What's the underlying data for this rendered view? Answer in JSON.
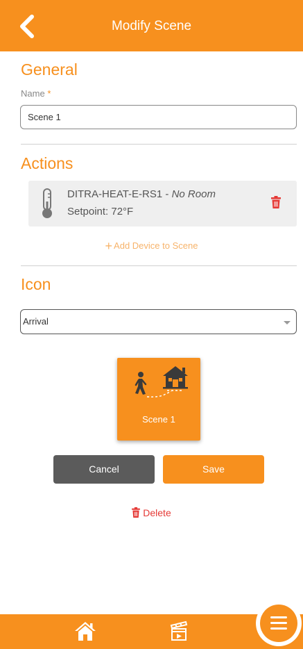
{
  "header": {
    "title": "Modify Scene",
    "back_icon": "chevron-left-icon"
  },
  "general": {
    "title": "General",
    "name_label": "Name",
    "required_mark": "*",
    "name_value": "Scene 1"
  },
  "actions": {
    "title": "Actions",
    "devices": [
      {
        "name": "DITRA-HEAT-E-RS1",
        "separator": " - ",
        "room": "No Room",
        "setpoint": "Setpoint: 72°F",
        "icon": "thermometer-icon"
      }
    ],
    "add_device_label": "Add Device to Scene"
  },
  "icon_section": {
    "title": "Icon",
    "selected": "Arrival"
  },
  "preview": {
    "label": "Scene 1",
    "icon": "arrival-icon"
  },
  "buttons": {
    "cancel": "Cancel",
    "save": "Save",
    "delete": "Delete"
  },
  "colors": {
    "accent": "#f7901e",
    "danger": "#e53935",
    "card_bg": "#efefef",
    "cancel_bg": "#5b5b5b"
  },
  "footer": {
    "home_icon": "home-icon",
    "scenes_icon": "scenes-icon",
    "menu_icon": "menu-icon"
  }
}
